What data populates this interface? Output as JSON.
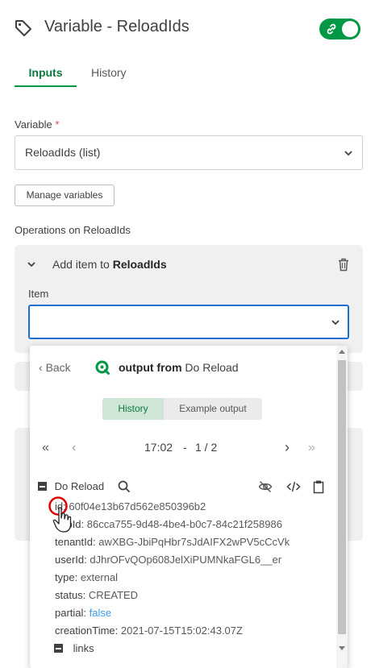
{
  "header": {
    "title": "Variable - ReloadIds",
    "toggle_on": true
  },
  "tabs": [
    {
      "label": "Inputs",
      "active": true
    },
    {
      "label": "History",
      "active": false
    }
  ],
  "variable": {
    "label": "Variable",
    "required_mark": "*",
    "selected": "ReloadIds (list)"
  },
  "manage_label": "Manage variables",
  "operations": {
    "label": "Operations on ReloadIds",
    "op_prefix": "Add item to ",
    "op_target": "ReloadIds",
    "item_label": "Item",
    "item_value": ""
  },
  "popup": {
    "back_label": "Back",
    "title_bold": "output from",
    "title_rest": " Do Reload",
    "segments": {
      "history": "History",
      "example": "Example output"
    },
    "time": "17:02",
    "sep": "-",
    "page": "1 / 2",
    "tree_root": "Do Reload",
    "fields": [
      {
        "key": "id:",
        "value": "60f04e13b67d562e850396b2"
      },
      {
        "key": "appId:",
        "value": "86cca755-9d48-4be4-b0c7-84c21f258986"
      },
      {
        "key": "tenantId:",
        "value": "awXBG-JbiPqHbr7sJdAIFX2wPV5cCcVk"
      },
      {
        "key": "userId:",
        "value": "dJhrOFvQOp608JelXiPUMNkaFGL6__er"
      },
      {
        "key": "type:",
        "value": "external"
      },
      {
        "key": "status:",
        "value": "CREATED"
      },
      {
        "key": "partial:",
        "value": "false"
      },
      {
        "key": "creationTime:",
        "value": "2021-07-15T15:02:43.07Z"
      }
    ],
    "links_label": "links"
  },
  "colors": {
    "accent": "#009845",
    "focus": "#1a6fd3",
    "link": "#3d9df2",
    "highlight": "#e00000"
  }
}
